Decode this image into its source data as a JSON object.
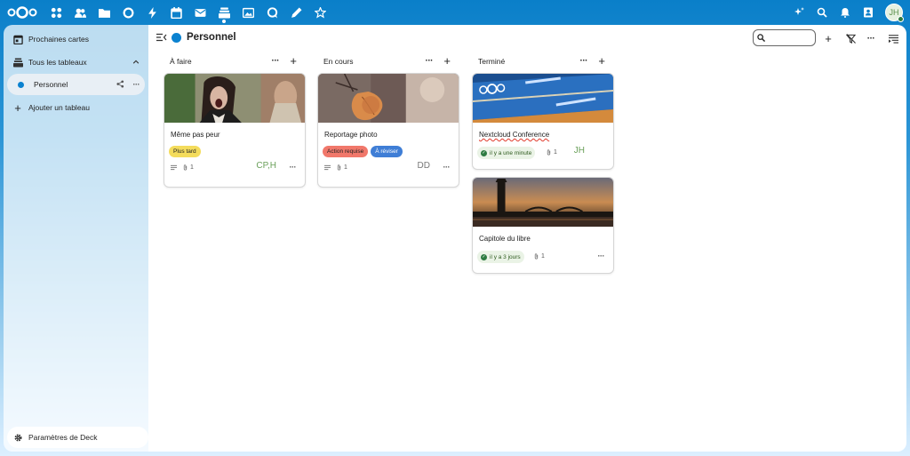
{
  "topbar": {
    "apps": [
      {
        "name": "dashboard-icon"
      },
      {
        "name": "contacts-icon"
      },
      {
        "name": "files-icon"
      },
      {
        "name": "circles-icon"
      },
      {
        "name": "activity-icon"
      },
      {
        "name": "calendar-icon"
      },
      {
        "name": "mail-icon"
      },
      {
        "name": "deck-icon",
        "active": true
      },
      {
        "name": "photos-icon"
      },
      {
        "name": "talk-icon"
      },
      {
        "name": "notes-icon"
      },
      {
        "name": "assistant-icon"
      }
    ],
    "user_initials": "JH"
  },
  "sidebar": {
    "upcoming_label": "Prochaines cartes",
    "all_boards_label": "Tous les tableaux",
    "board_label": "Personnel",
    "add_board_label": "Ajouter un tableau",
    "settings_label": "Paramètres de Deck"
  },
  "board": {
    "title": "Personnel",
    "color": "#0b82d0"
  },
  "stacks": [
    {
      "title": "À faire",
      "cards": [
        {
          "title": "Même pas peur",
          "labels": [
            {
              "text": "Plus tard",
              "color": "#f4dc5c",
              "text_color": "#222"
            }
          ],
          "attachments": "1",
          "assignees": "CP,H"
        }
      ]
    },
    {
      "title": "En cours",
      "cards": [
        {
          "title": "Reportage photo",
          "labels": [
            {
              "text": "Action requise",
              "color": "#f1786b",
              "text_color": "#222"
            },
            {
              "text": "À réviser",
              "color": "#3f7ed6",
              "text_color": "#fff"
            }
          ],
          "attachments": "1",
          "assignees": "DD"
        }
      ]
    },
    {
      "title": "Terminé",
      "cards": [
        {
          "title": "Nextcloud Conference",
          "due": "il y a une minute",
          "attachments": "1",
          "assignees": "JH"
        },
        {
          "title": "Capitole du libre",
          "due": "il y a 3 jours",
          "attachments": "1"
        }
      ]
    }
  ],
  "colors": {
    "accent": "#0b82d0",
    "done_badge": "#2d7b41"
  }
}
